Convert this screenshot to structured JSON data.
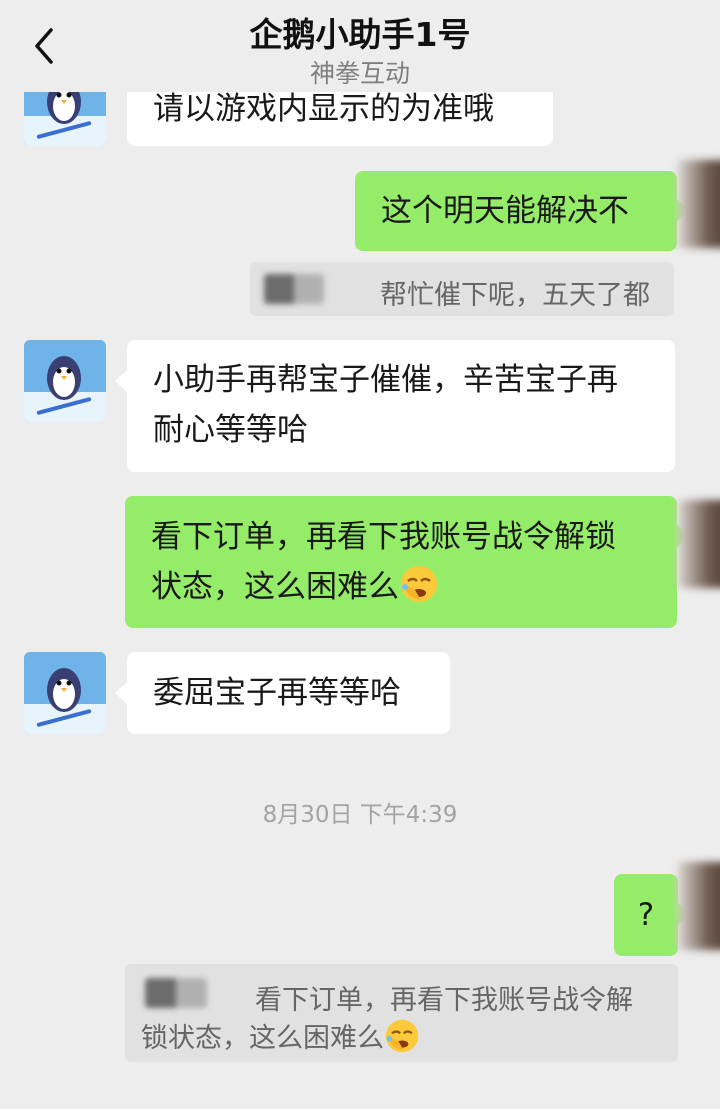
{
  "header": {
    "title": "企鹅小助手1号",
    "subtitle": "神拳互动"
  },
  "messages": [
    {
      "side": "in",
      "text": "请以游戏内显示的为准哦"
    },
    {
      "side": "out",
      "text": "这个明天能解决不"
    },
    {
      "side": "quote",
      "text": "帮忙催下呢，五天了都"
    },
    {
      "side": "in",
      "line1": "小助手再帮宝子催催，辛苦宝子再",
      "line2": "耐心等等哈"
    },
    {
      "side": "out",
      "line1": "看下订单，再看下我账号战令解锁",
      "line2": "状态，这么困难么"
    },
    {
      "side": "in",
      "text": "委屈宝子再等等哈"
    },
    {
      "side": "out",
      "text": "?"
    },
    {
      "side": "quote",
      "line1": "看下订单，再看下我账号战令解",
      "line2": "锁状态，这么困难么"
    }
  ],
  "timestamp": "8月30日 下午4:39",
  "icons": {
    "back": "chevron-left-icon",
    "emoji": "facepalm-emoji",
    "avatar": "penguin-skier-avatar"
  },
  "colors": {
    "background": "#ededed",
    "outgoing_bubble": "#95ec69",
    "incoming_bubble": "#ffffff",
    "quote_block": "#e1e1e1"
  }
}
